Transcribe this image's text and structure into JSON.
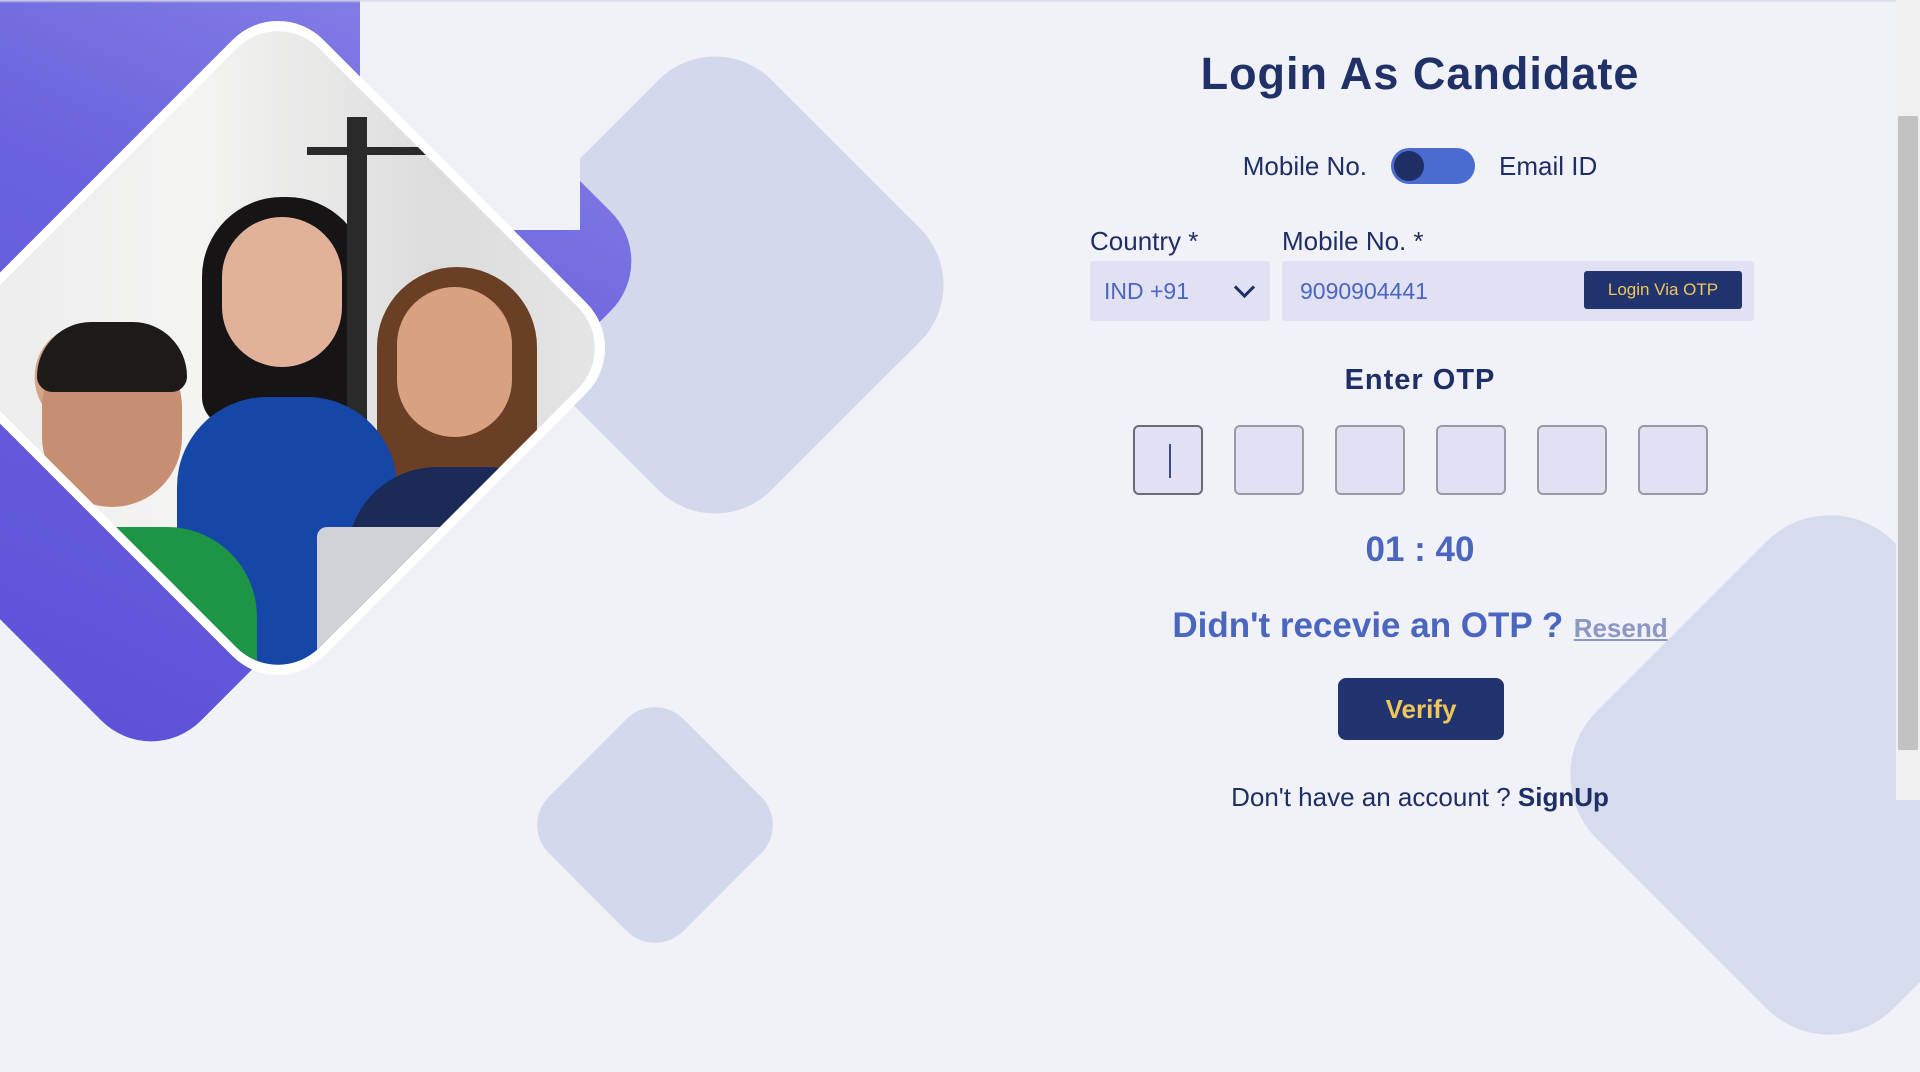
{
  "login": {
    "title": "Login As Candidate",
    "toggle_left": "Mobile No.",
    "toggle_right": "Email ID",
    "country_label": "Country *",
    "country_value": "IND +91",
    "mobile_label": "Mobile No. *",
    "mobile_value": "9090904441",
    "otp_button": "Login Via OTP",
    "enter_otp": "Enter OTP",
    "otp_digits": [
      "",
      "",
      "",
      "",
      "",
      ""
    ],
    "timer": "01 : 40",
    "resend_question": "Didn't recevie an OTP ?",
    "resend_link": "Resend",
    "verify_button": "Verify",
    "signup_text": "Don't have an account ?",
    "signup_link": "SignUp"
  },
  "colors": {
    "primary_navy": "#22346f",
    "accent_gold": "#f0c75a",
    "link_blue": "#4a66bf",
    "purple": "#6a63dd",
    "input_bg": "#e1e1f3"
  }
}
